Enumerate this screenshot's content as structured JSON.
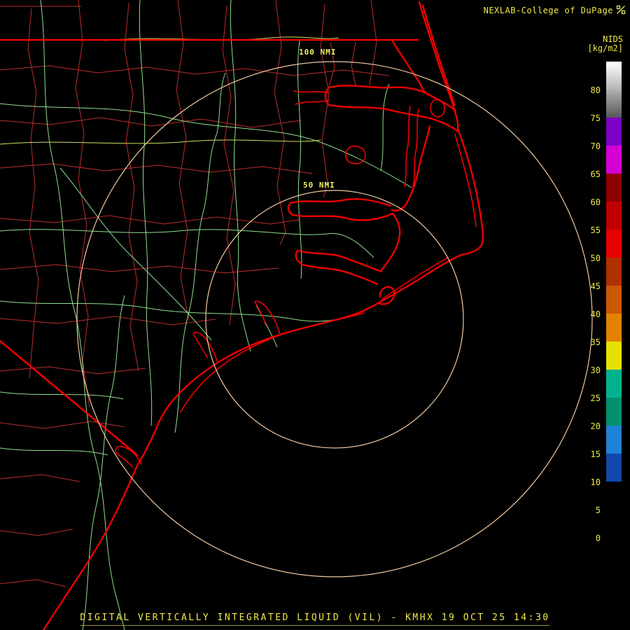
{
  "header": {
    "brand": "NEXLAB-College of DuPage"
  },
  "colorbar": {
    "title": "NIDS",
    "units": "[kg/m2]",
    "segments": [
      {
        "label": "80",
        "color": "linear-gradient(180deg,#ffffff,#b4b4b4)"
      },
      {
        "label": "75",
        "color": "linear-gradient(180deg,#b0b0b0,#585858)"
      },
      {
        "label": "70",
        "color": "#7d00c8"
      },
      {
        "label": "65",
        "color": "#d400d4"
      },
      {
        "label": "60",
        "color": "#8e0000"
      },
      {
        "label": "55",
        "color": "#c00000"
      },
      {
        "label": "50",
        "color": "#e60000"
      },
      {
        "label": "45",
        "color": "#b03000"
      },
      {
        "label": "40",
        "color": "#cc5800"
      },
      {
        "label": "35",
        "color": "#e38200"
      },
      {
        "label": "30",
        "color": "#e8e000"
      },
      {
        "label": "25",
        "color": "#00b28e"
      },
      {
        "label": "20",
        "color": "#00906e"
      },
      {
        "label": "15",
        "color": "#1e82d8"
      },
      {
        "label": "10",
        "color": "#1048ae"
      },
      {
        "label": "5",
        "color": "#000000"
      },
      {
        "label": "0",
        "color": "#000000"
      },
      {
        "label": null,
        "color": "#000000"
      }
    ]
  },
  "rings": [
    {
      "label": "100 NMI"
    },
    {
      "label": "50 NMI"
    }
  ],
  "footer": {
    "title": "DIGITAL VERTICALLY INTEGRATED LIQUID (VIL) - KMHX 19 OCT 25 14:30"
  },
  "colors": {
    "bg": "#000000",
    "coast": "#f00000",
    "county": "#c83030",
    "road": "#8fe08f",
    "road-alt": "#cede60",
    "ring": "#f2c9a0",
    "text-yellow": "#f0e84c",
    "label-yellow": "#f0f060"
  }
}
